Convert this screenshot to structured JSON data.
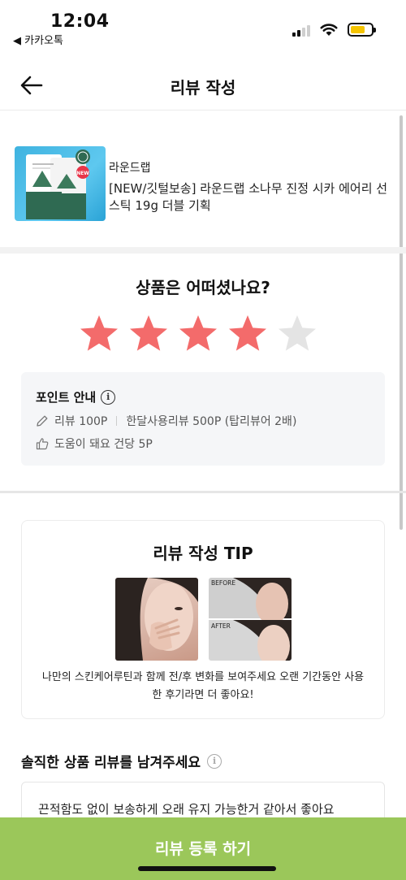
{
  "status_bar": {
    "time": "12:04",
    "back_app": "◀ 카카오톡"
  },
  "header": {
    "title": "리뷰 작성"
  },
  "product": {
    "brand": "라운드랩",
    "name": "[NEW/깃털보송] 라운드랩 소나무 진정 시카 에어리 선스틱 19g 더블 기획",
    "badge": "NEW"
  },
  "rating": {
    "question": "상품은 어떠셨나요?",
    "value": 4,
    "max": 5,
    "filled_color": "#f36b6b",
    "empty_color": "#e4e4e4"
  },
  "points": {
    "title": "포인트 안내",
    "review_points": "리뷰 100P",
    "month_review_points": "한달사용리뷰 500P (탑리뷰어 2배)",
    "helpful_points": "도움이 돼요 건당 5P"
  },
  "tip": {
    "title": "리뷰 작성 TIP",
    "before_label": "BEFORE",
    "after_label": "AFTER",
    "text": "나만의 스킨케어루틴과 함께 전/후 변화를 보여주세요 오랜 기간동안 사용한 후기라면 더 좋아요!"
  },
  "review": {
    "label": "솔직한 상품 리뷰를 남겨주세요",
    "value": "끈적함도 없이 보송하게 오래 유지 가능한거 같아서 좋아요"
  },
  "submit": {
    "label": "리뷰 등록 하기",
    "color": "#9bc75a"
  }
}
